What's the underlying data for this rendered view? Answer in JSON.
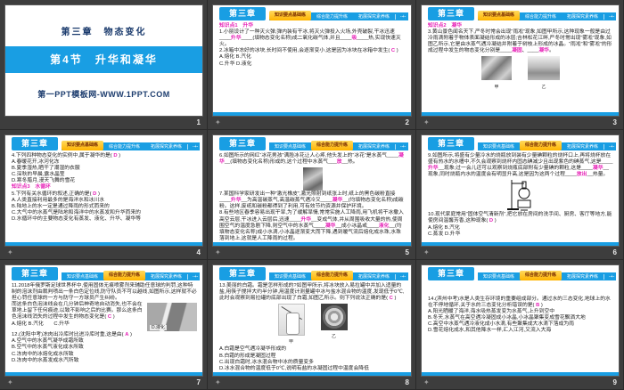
{
  "colors": {
    "accent_blue": "#199ee3",
    "tab_active_bg": "#ffb400",
    "tab_active_text": "#7a2c00",
    "answer_magenta": "#e620b6",
    "cover_navy": "#1c3c6e",
    "sorter_background": "#3d3d3d"
  },
  "chapter_badge": "第三章",
  "transition_star": "✦",
  "tabs": {
    "items": [
      "知识要点基础练",
      "综合能力提升练",
      "拓展探究素养练"
    ],
    "nav_icon": "-+-"
  },
  "cover": {
    "chapter_line": "第三章　物态变化",
    "section_line": "第4节　升华和凝华",
    "site": "第一PPT模板网-WWW.1PPT.COM",
    "page": "1"
  },
  "slides": [
    {
      "page": "2",
      "kp": "知识点1　升华",
      "q1": [
        [
          "1.小丽设计了一种灭火弹,弹内装有干冰,将灭火弹投入火场,外壳破裂,干冰迅速____"
        ],
        [
          "升华",
          1
        ],
        [
          "____(填物态变化名称)成二氧化碳气体,并且____"
        ],
        [
          "吸",
          1
        ],
        [
          "____热,实现快速灭火。"
        ]
      ],
      "q2": [
        [
          "2.冰箱中冻好的冰块,长时间不使用,会逐渐变小,这是因为冰块在冰箱中发生( "
        ],
        [
          "C",
          1
        ],
        [
          " )"
        ]
      ],
      "opts": [
        "A.熔化 B.汽化",
        "C.升华 D.液化"
      ]
    },
    {
      "page": "3",
      "kp": "知识点2　凝华",
      "q3": [
        [
          "3.黄山景色闻名天下,严冬时常会出现“雨凇”现象,如图甲所示,这种现象一般是由过冷雨滴附着于物体表面凝结形成的冰层;吉林松花江畔,严冬时常出现“雾凇”现象,如图乙所示,它是由水蒸气遇冷凝结并附着于树枝上形成的冰晶。“雨凇”和“雾凇”的形成过程中发生的物态变化分别是____"
        ],
        [
          "凝固",
          1
        ],
        [
          "、____"
        ],
        [
          "凝华",
          1
        ],
        [
          "。"
        ]
      ],
      "img_labels": [
        "甲",
        "乙"
      ]
    },
    {
      "page": "4",
      "q4": [
        [
          "4.下列四种物态变化的实例中,属于凝华的是( "
        ],
        [
          "D",
          1
        ],
        [
          " )"
        ]
      ],
      "q4_opts": [
        "A.春暖花开,冰河化冻",
        "B.夏季湿热,晒干了潮湿的衣服",
        "C.深秋的早晨,露水晶莹",
        "D.寒冬腊月,漫天飞舞的雪花"
      ],
      "kp": "知识点3　水循环",
      "q5": [
        [
          "5.下列有关水循环的叙述,正确的是( "
        ],
        [
          "D",
          1
        ],
        [
          " )"
        ]
      ],
      "q5_opts": [
        "A.人类直接利用最多的是海洋水和冰川水",
        "B.陆地上的水一定是通过降雨的形式而来的",
        "C.大气中的水蒸气是陆地和海洋中的水蒸发和升华而来的",
        "D.水循环中的主要物态变化有蒸发、液化、升华、凝华等"
      ]
    },
    {
      "page": "5",
      "q6": [
        [
          "6.如图所示的网红“冰花男孩”满脸冰花让人心疼,他头发上的“冰花”是水蒸气____"
        ],
        [
          "凝华",
          1
        ],
        [
          "__(填物态变化名称)形成的,这个过程中水蒸气___"
        ],
        [
          "放",
          1
        ],
        [
          "__热。"
        ]
      ],
      "q7": [
        [
          "7.某国科学家研发出一种“激光橡皮”,激光照射到纸张上时,纸上的黑色碳粉直接____"
        ],
        [
          "升华",
          1
        ],
        [
          "__为高温碳蒸气,高温碳蒸气遇冷又____"
        ],
        [
          "凝华",
          1
        ],
        [
          "__(均填物态变化名称)成碳粉。这样,废纸和碳粉都得到了利用,可有效节约资源并保护环境。"
        ]
      ],
      "q8": [
        [
          "8.有些地区春季容易出现干旱,为了缓解旱情,常常实施人工降雨,用飞机将干冰撒入高空云层,干冰进入云层后,迅速____"
        ],
        [
          "升华",
          1
        ],
        [
          "__变成气体,并从周围吸收大量的热,使周围空气的温度急剧下降,则空气中的水蒸气____"
        ],
        [
          "凝华",
          1
        ],
        [
          "__成小冰晶或____"
        ],
        [
          "液化",
          1
        ],
        [
          "__(均填物态变化名称)成小水滴,小冰晶逐渐变大而下降,遇到暖气流后熔化成水珠,水珠落到地上,这就是人工降雨的过程。"
        ]
      ]
    },
    {
      "page": "6",
      "q9": [
        [
          "9.如图所示,将盛有少量冷水的烧瓶放到装有少量碘颗粒的烧杯口上,再将烧杯放在盛有热水的水槽中,不久会观察到烧杯内固态碘减少且出现紫色的碘蒸气,这是____"
        ],
        [
          "升华",
          1
        ],
        [
          "__现象;过一会儿还可以观察到烧瓶底部附有少量碘的颗粒,这是____"
        ],
        [
          "凝华",
          1
        ],
        [
          "__现象,同时烧瓶内水的温度会有明显升高,这是因为这两个过程____"
        ],
        [
          "放出",
          1
        ],
        [
          "__热量。"
        ]
      ],
      "q10": [
        [
          "10.现代家庭常用“固体空气清新剂”,把它放在房间的洗手间、厨房、客厅等地方,能使房间温馨芳香,这种现象( "
        ],
        [
          "D",
          1
        ],
        [
          " )"
        ]
      ],
      "opts": [
        "A.熔化 B.汽化",
        "C.蒸发 D.升华"
      ]
    },
    {
      "page": "7",
      "q11a": "11.2018年俄罗斯足球世界杯中,使用固体无痕喷雾剂来辅助任意球的判罚,这种特制的泡沫剂由裁判喷出一条白色定位线,防守队员不可以越线,如图所示,这样就不必担心罚任意球的一方与防守一方球员产生纠纷。",
      "q11b": [
        [
          "而这条白色泡沫线会在几分钟后神奇地自动消失,也不会在草地上留下任何痕迹,以致不影响之后的比赛。那么这条白色泡沫线消失的过程中发生的物态变化是( "
        ],
        [
          "C",
          1
        ],
        [
          " )"
        ]
      ],
      "q11_opts": "A.熔化 B.汽化　　C.升华",
      "q11_optD": "D.液化",
      "q12": [
        [
          "12.(沈阳中考)冻肉出冷库时比进冷库时重,这是由( "
        ],
        [
          "A",
          1
        ],
        [
          " )"
        ]
      ],
      "q12_opts": [
        "A.空气中的水蒸气凝华成霜所致",
        "B.空气中的水蒸气液化成水所致",
        "C.冻肉中的冰熔化成水所致",
        "D.冻肉中的水蒸发成水汽所致"
      ]
    },
    {
      "page": "8",
      "q13": [
        [
          "13.美丽的白霜。霜是怎样形成的?如图甲所示,将冰块放入易拉罐中并加入适量的盐,用筷子搅拌大约半分钟,用温度计测量罐中冰与盐水混合物的温度,发现低于0℃,此时会观察到易拉罐的底部出现了白霜,如图乙所示。则下列说法正确的是( "
        ],
        [
          "C",
          1
        ],
        [
          " )"
        ]
      ],
      "img_labels": [
        "甲",
        "乙"
      ],
      "q13_opts": [
        "A.白霜是空气遇冷凝华形成的",
        "B.白霜的形成是凝固过程",
        "C.出现白霜时,冰水混合物中冰的质量变多",
        "D.冰水混合物的温度低于0℃,说明有盐的水凝固过程中温度会降低"
      ]
    },
    {
      "page": "9",
      "q14": [
        [
          "14.(滨州中考)水是人类生存环境的重要组成部分。通过水的三态变化,地球上的水在不停地循环,关于水的三态变化分析错误的是( "
        ],
        [
          "B",
          1
        ],
        [
          " )"
        ]
      ],
      "q14_opts": [
        "A.阳光晒暖了海洋,海水吸热蒸发变为水蒸气,上升到空中",
        "B.冬天,水蒸气在高空遇冷凝固成小冰晶,小冰晶聚集变成雪花飘洒大地",
        "C.高空中水蒸气遇冷液化成小水滴,有些聚集成大水滴下落成为雨",
        "D.雪花熔化成水,和其他降水一样,汇入江河,又流入大海"
      ]
    }
  ]
}
